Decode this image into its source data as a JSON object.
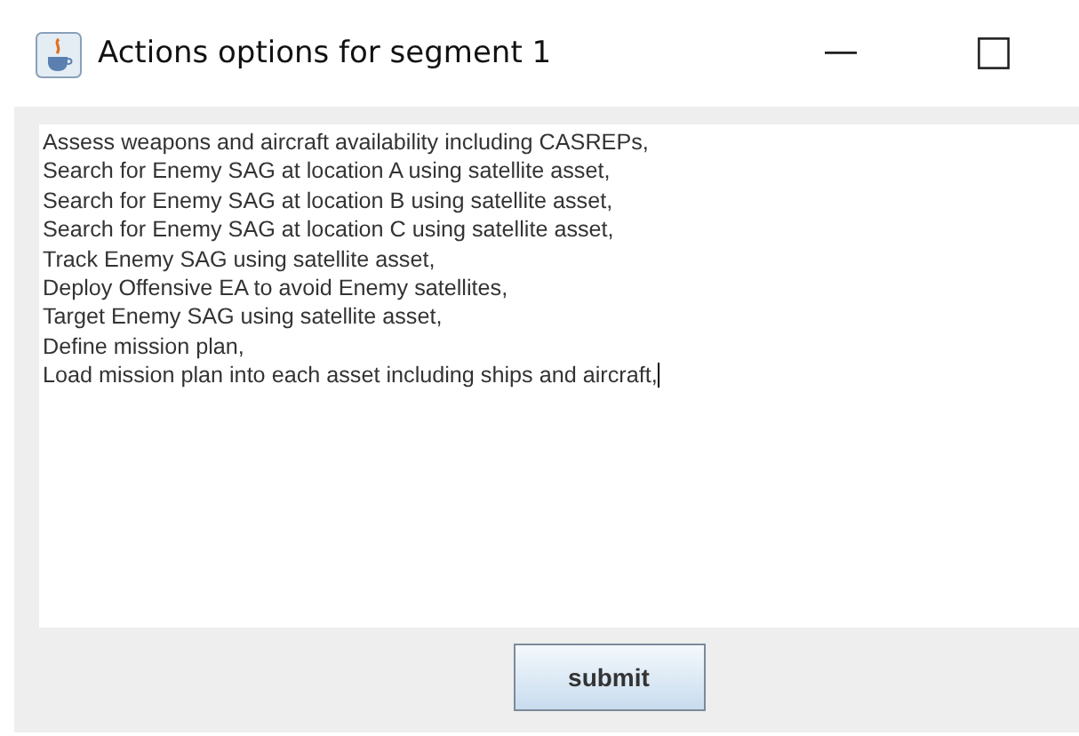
{
  "window": {
    "title": "Actions options for segment 1"
  },
  "text_area": {
    "lines": [
      "Assess weapons and aircraft availability including CASREPs,",
      "Search for Enemy SAG at location A using satellite asset,",
      "Search for Enemy SAG at location B using satellite asset,",
      "Search for Enemy SAG at location C using satellite asset,",
      "Track Enemy SAG using satellite asset,",
      "Deploy Offensive EA to avoid Enemy satellites,",
      "Target Enemy SAG using satellite asset,",
      "Define mission plan,",
      "Load mission plan into each asset including ships and aircraft,"
    ],
    "focused": true
  },
  "buttons": [
    "submit"
  ]
}
